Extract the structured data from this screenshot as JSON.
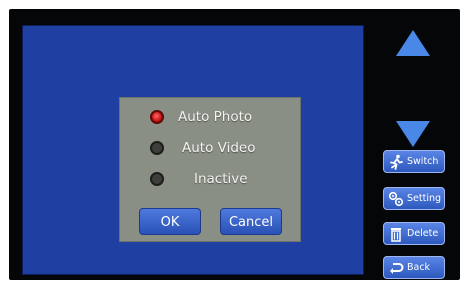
{
  "dialog": {
    "options": [
      {
        "label": "Auto Photo",
        "selected": true
      },
      {
        "label": "Auto Video",
        "selected": false
      },
      {
        "label": "Inactive",
        "selected": false
      }
    ],
    "ok_label": "OK",
    "cancel_label": "Cancel"
  },
  "nav": {
    "up_icon": "up-arrow-icon",
    "down_icon": "down-arrow-icon"
  },
  "side_buttons": [
    {
      "label": "Switch",
      "icon": "running-person-icon"
    },
    {
      "label": "Setting",
      "icon": "gears-icon"
    },
    {
      "label": "Delete",
      "icon": "trash-icon"
    },
    {
      "label": "Back",
      "icon": "return-arrow-icon"
    }
  ],
  "colors": {
    "screen": "#1f3fa3",
    "dialog": "#8a8f86",
    "button": "#2a52b6",
    "arrow": "#4a88e8",
    "radio_selected": "#d01818"
  }
}
